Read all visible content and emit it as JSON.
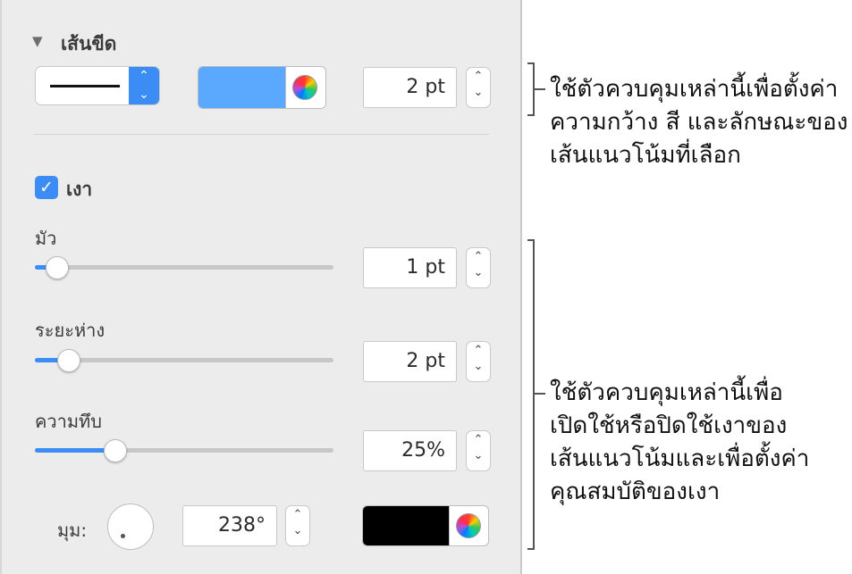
{
  "stroke": {
    "title": "เส้นขีด",
    "width_value": "2 pt",
    "color": "#5aa8ff"
  },
  "shadow": {
    "checkbox_label": "เงา",
    "checked": true,
    "blur": {
      "label": "มัว",
      "value": "1 pt",
      "level": 0.04
    },
    "offset": {
      "label": "ระยะห่าง",
      "value": "2 pt",
      "level": 0.08
    },
    "opacity": {
      "label": "ความทึบ",
      "value": "25%",
      "level": 0.25
    },
    "angle": {
      "label": "มุม:",
      "value": "238°"
    },
    "color": "#000000"
  },
  "callouts": {
    "stroke_text": [
      "ใช้ตัวควบคุมเหล่านี้เพื่อตั้งค่า",
      "ความกว้าง สี และลักษณะของ",
      "เส้นแนวโน้มที่เลือก"
    ],
    "shadow_text": [
      "ใช้ตัวควบคุมเหล่านี้เพื่อ",
      "เปิดใช้หรือปิดใช้เงาของ",
      "เส้นแนวโน้มและเพื่อตั้งค่า",
      "คุณสมบัติของเงา"
    ]
  },
  "icons": {
    "disclosure": "disclosure-triangle-icon",
    "checkmark": "checkmark-icon",
    "color_wheel": "color-wheel-icon",
    "stepper": "stepper-icon",
    "select_chevron": "chevron-updown-icon"
  }
}
